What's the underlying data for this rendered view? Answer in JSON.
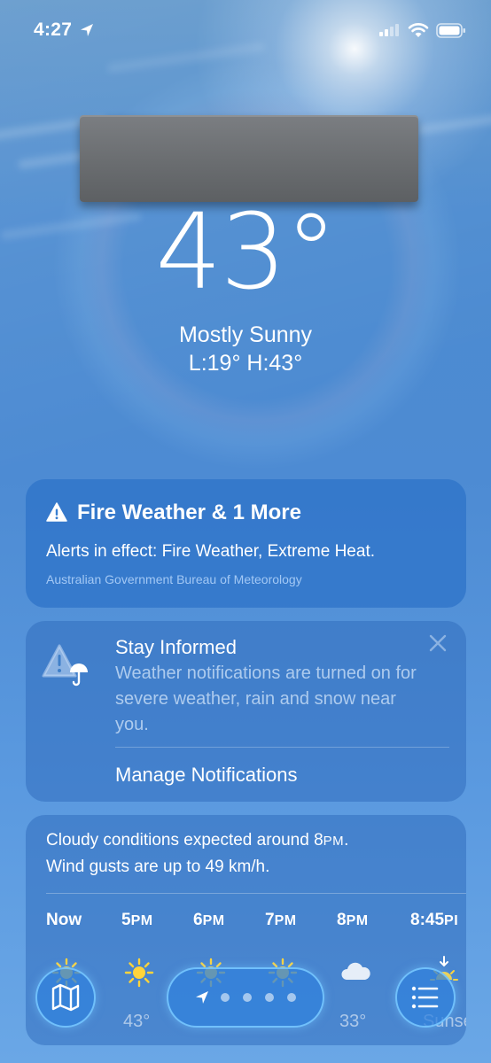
{
  "status_bar": {
    "time": "4:27",
    "icons": [
      "location-arrow-icon",
      "cellular-signal-icon",
      "wifi-icon",
      "battery-icon"
    ]
  },
  "current": {
    "temperature": "43°",
    "condition": "Mostly Sunny",
    "low_high": "L:19° H:43°"
  },
  "alert": {
    "icon": "warning-triangle-icon",
    "title": "Fire Weather & 1 More",
    "text": "Alerts in effect: Fire Weather, Extreme Heat.",
    "source": "Australian Government Bureau of Meteorology"
  },
  "stay_informed": {
    "icon": "alert-umbrella-icon",
    "title": "Stay Informed",
    "text": "Weather notifications are turned on for severe weather, rain and snow near you.",
    "button": "Manage Notifications",
    "close_icon": "close-icon"
  },
  "forecast": {
    "summary_part1": "Cloudy conditions expected around 8",
    "summary_pm": "PM",
    "summary_part2": ".",
    "summary_line2": "Wind gusts are up to 49 km/h.",
    "hours": [
      {
        "time": "Now",
        "suffix": "",
        "icon": "sun-icon",
        "temp": ""
      },
      {
        "time": "5",
        "suffix": "PM",
        "icon": "sun-icon",
        "temp": "43°"
      },
      {
        "time": "6",
        "suffix": "PM",
        "icon": "sun-icon",
        "temp": ""
      },
      {
        "time": "7",
        "suffix": "PM",
        "icon": "sun-icon",
        "temp": ""
      },
      {
        "time": "8",
        "suffix": "PM",
        "icon": "cloud-icon",
        "temp": "33°"
      },
      {
        "time": "8:45",
        "suffix": "PI",
        "icon": "sunset-icon",
        "temp": "Sunse"
      }
    ]
  },
  "nav": {
    "map_icon": "map-icon",
    "location_icon": "location-arrow-icon",
    "list_icon": "list-icon",
    "page_count": 4
  },
  "colors": {
    "sky_blue": "#4d8bd3",
    "card_blue": "#2d73c8",
    "nav_border": "#78c8ff"
  }
}
